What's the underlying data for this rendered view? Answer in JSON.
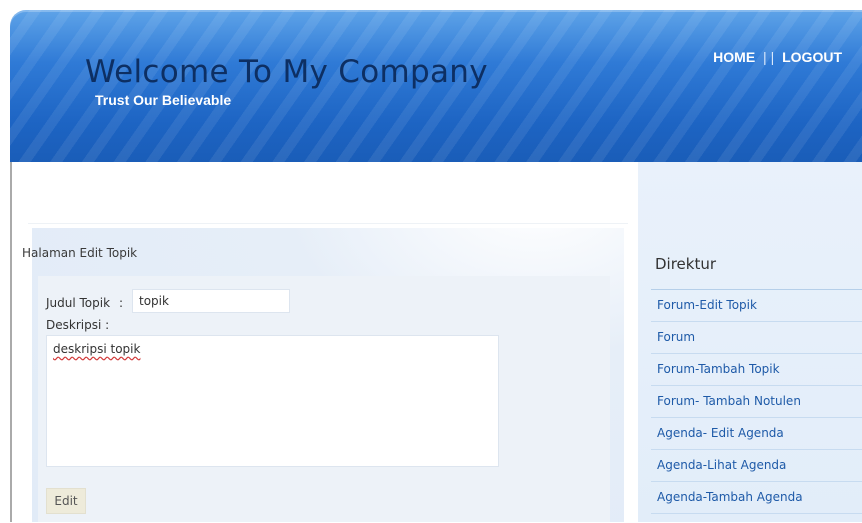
{
  "header": {
    "title": "Welcome To My Company",
    "tagline": "Trust Our Believable",
    "nav": {
      "home_label": "HOME",
      "separator": "| |",
      "logout_label": "LOGOUT"
    }
  },
  "main": {
    "heading": "Halaman Edit Topik",
    "form": {
      "judul_label": "Judul Topik",
      "colon": ":",
      "judul_value": "topik",
      "deskripsi_label": "Deskripsi :",
      "deskripsi_value": "deskripsi topik",
      "edit_button_label": "Edit"
    }
  },
  "sidebar": {
    "title": "Direktur",
    "items": [
      {
        "label": "Forum-Edit Topik"
      },
      {
        "label": "Forum"
      },
      {
        "label": "Forum-Tambah Topik"
      },
      {
        "label": "Forum- Tambah Notulen"
      },
      {
        "label": "Agenda- Edit Agenda"
      },
      {
        "label": "Agenda-Lihat Agenda"
      },
      {
        "label": "Agenda-Tambah Agenda"
      }
    ]
  },
  "colors": {
    "header_blue": "#2f7ad6",
    "title_navy": "#0d2f63",
    "sidebar_bg": "#e9f1fb",
    "link_blue": "#1e5aa8",
    "button_bg": "#eeebda"
  }
}
